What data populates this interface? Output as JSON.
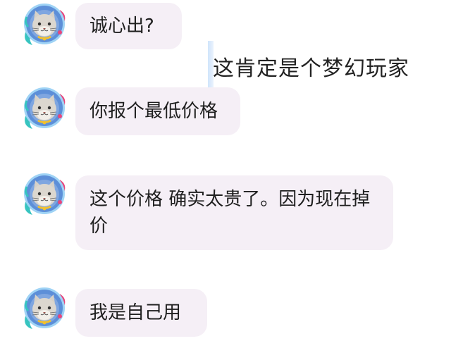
{
  "chat": {
    "messages": [
      {
        "text": "诚心出?"
      },
      {
        "text": "你报个最低价格"
      },
      {
        "text": "这个价格 确实太贵了。因为现在掉价"
      },
      {
        "text": "我是自己用"
      }
    ],
    "overlay_caption": "这肯定是个梦幻玩家"
  },
  "colors": {
    "bubble_bg": "#f5eff6",
    "avatar_ring": "#3a9fe0",
    "avatar_bg": "#5b8fd6",
    "cat_face": "#d9d4cc"
  },
  "icons": {
    "avatar": "astronaut-cat-avatar-icon"
  }
}
